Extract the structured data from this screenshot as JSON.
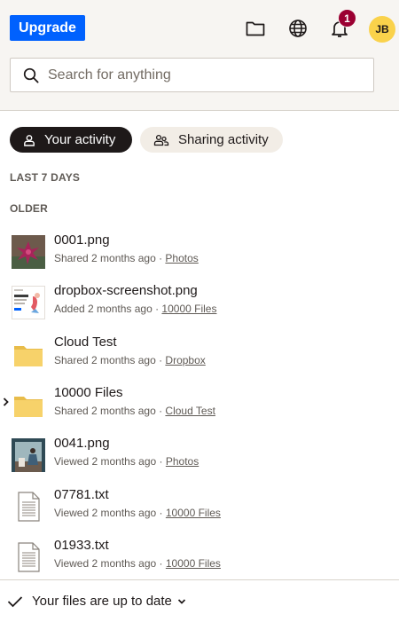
{
  "header": {
    "upgrade_label": "Upgrade",
    "notification_count": "1",
    "avatar_initials": "JB",
    "icons": [
      "folder-icon",
      "globe-icon",
      "bell-icon"
    ]
  },
  "search": {
    "placeholder": "Search for anything",
    "value": ""
  },
  "tabs": [
    {
      "label": "Your activity",
      "icon": "person-icon",
      "active": true
    },
    {
      "label": "Sharing activity",
      "icon": "people-icon",
      "active": false
    }
  ],
  "sections": {
    "last7": "LAST 7 DAYS",
    "older": "OLDER"
  },
  "files": [
    {
      "name": "0001.png",
      "action": "Shared 2 months ago ·",
      "location": "Photos",
      "icon": "image-thumbnail-icon"
    },
    {
      "name": "dropbox-screenshot.png",
      "action": "Added 2 months ago ·",
      "location": "10000 Files",
      "icon": "screenshot-thumbnail-icon"
    },
    {
      "name": "Cloud Test",
      "action": "Shared 2 months ago ·",
      "location": "Dropbox",
      "icon": "folder-icon"
    },
    {
      "name": "10000 Files",
      "action": "Shared 2 months ago ·",
      "location": "Cloud Test",
      "icon": "folder-icon"
    },
    {
      "name": "0041.png",
      "action": "Viewed 2 months ago ·",
      "location": "Photos",
      "icon": "image-thumbnail-icon"
    },
    {
      "name": "07781.txt",
      "action": "Viewed 2 months ago ·",
      "location": "10000 Files",
      "icon": "text-file-icon"
    },
    {
      "name": "01933.txt",
      "action": "Viewed 2 months ago ·",
      "location": "10000 Files",
      "icon": "text-file-icon"
    }
  ],
  "footer": {
    "status": "Your files are up to date"
  },
  "colors": {
    "accent": "#0061fe",
    "badge": "#9b0032",
    "avatar": "#fad24b",
    "folder": "#f7d26a"
  }
}
